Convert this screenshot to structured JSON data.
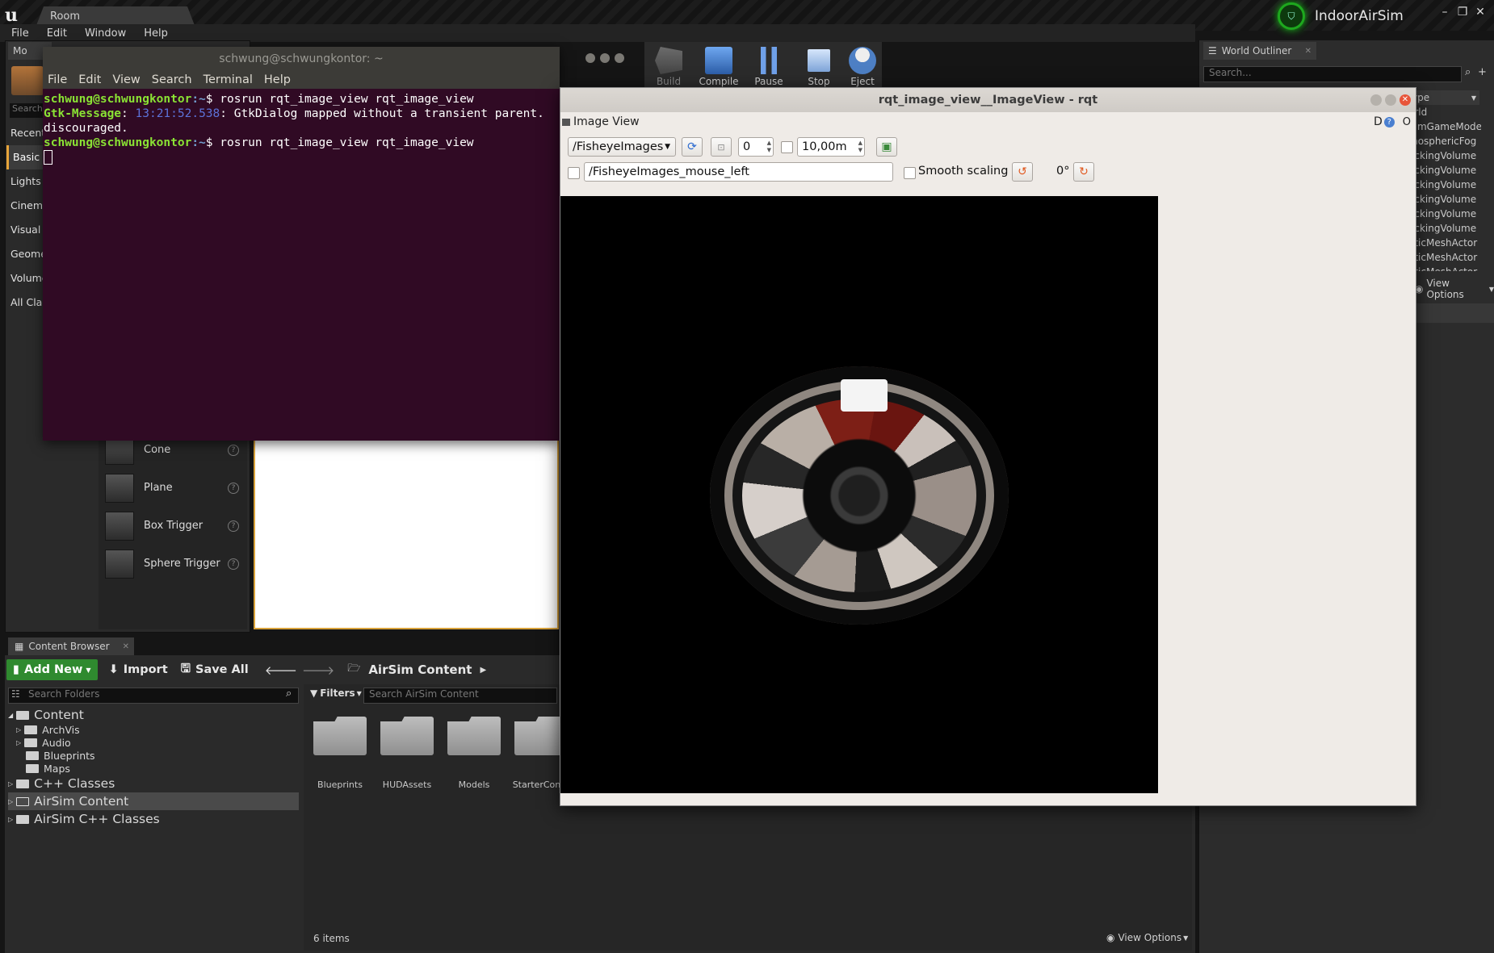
{
  "ue": {
    "tab_label": "Room",
    "project_name": "IndoorAirSim",
    "menu": [
      "File",
      "Edit",
      "Window",
      "Help"
    ],
    "modes_tab": "Mo",
    "modes_search": "Search",
    "categories": [
      "Recent",
      "Basic",
      "Lights",
      "Cinema",
      "Visual E",
      "Geome",
      "Volume",
      "All Clas"
    ],
    "place_items": [
      "Cone",
      "Plane",
      "Box Trigger",
      "Sphere Trigger"
    ],
    "toolbar": [
      "Build",
      "Compile",
      "Pause",
      "Stop",
      "Eject"
    ],
    "outliner": {
      "tab": "World Outliner",
      "search_placeholder": "Search...",
      "column": "ype",
      "rows": [
        "orld",
        "SimGameMode",
        "mosphericFog",
        "ockingVolume",
        "ockingVolume",
        "ockingVolume",
        "ockingVolume",
        "ockingVolume",
        "ockingVolume",
        "aticMeshActor",
        "aticMeshActor",
        "aticMeshActor"
      ],
      "view_options": "View Options"
    },
    "content_browser": {
      "tab": "Content Browser",
      "add_new": "Add New",
      "import": "Import",
      "save_all": "Save All",
      "path": "AirSim Content",
      "search_folders": "Search Folders",
      "filters": "Filters",
      "search_assets": "Search AirSim Content",
      "tree": {
        "root": "Content",
        "children": [
          "ArchVis",
          "Audio",
          "Blueprints",
          "Maps"
        ],
        "cpp": "C++ Classes",
        "airsim": "AirSim Content",
        "airsim_cpp": "AirSim C++ Classes"
      },
      "assets": [
        "Blueprints",
        "HUDAssets",
        "Models",
        "StarterConte"
      ],
      "item_count": "6 items",
      "view_options": "View Options"
    }
  },
  "terminal": {
    "title": "schwung@schwungkontor: ~",
    "menu": [
      "File",
      "Edit",
      "View",
      "Search",
      "Terminal",
      "Help"
    ],
    "prompt_user": "schwung@schwungkontor",
    "prompt_path": ":~",
    "command": "rosrun rqt_image_view rqt_image_view",
    "msg_label": "Gtk-Message",
    "msg_time": "13:21:52.538",
    "msg_text": ": GtkDialog mapped without a transient parent.",
    "msg_cont": "discouraged."
  },
  "rqt": {
    "title": "rqt_image_view__ImageView - rqt",
    "plugin_title": "Image View",
    "dhelp": "D",
    "topic": "/FisheyeImages",
    "spin_value": "0",
    "distance": "10,00m",
    "mouse_topic": "/FisheyeImages_mouse_left",
    "smooth_label": "Smooth scaling",
    "rotation": "0°"
  }
}
